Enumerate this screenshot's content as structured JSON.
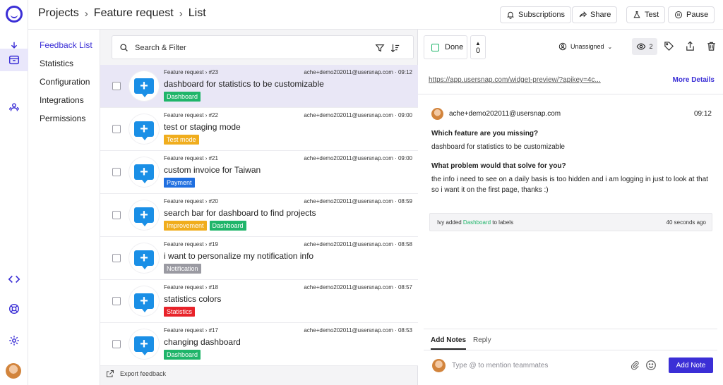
{
  "header": {
    "breadcrumb": [
      "Projects",
      "Feature request",
      "List"
    ],
    "buttons": {
      "subscriptions": "Subscriptions",
      "share": "Share",
      "test": "Test",
      "pause": "Pause"
    }
  },
  "rail": {
    "icons": [
      "download-icon",
      "inbox-icon",
      "team-icon",
      "code-icon",
      "lifebuoy-icon",
      "gear-icon"
    ]
  },
  "subnav": {
    "items": [
      "Feedback List",
      "Statistics",
      "Configuration",
      "Integrations",
      "Permissions"
    ]
  },
  "list": {
    "search_placeholder": "Search & Filter",
    "export_label": "Export feedback",
    "rows": [
      {
        "meta": "Feature request › #23",
        "email": "ache+demo202011@usersnap.com",
        "time": "09:12",
        "title": "dashboard for statistics to be customizable",
        "labels": [
          {
            "text": "Dashboard",
            "color": "#1fb56a"
          }
        ]
      },
      {
        "meta": "Feature request › #22",
        "email": "ache+demo202011@usersnap.com",
        "time": "09:00",
        "title": "test or staging mode",
        "labels": [
          {
            "text": "Test mode",
            "color": "#f0ad1d"
          }
        ]
      },
      {
        "meta": "Feature request › #21",
        "email": "ache+demo202011@usersnap.com",
        "time": "09:00",
        "title": "custom invoice for Taiwan",
        "labels": [
          {
            "text": "Payment",
            "color": "#1f6fe0"
          }
        ]
      },
      {
        "meta": "Feature request › #20",
        "email": "ache+demo202011@usersnap.com",
        "time": "08:59",
        "title": "search bar for dashboard to find projects",
        "labels": [
          {
            "text": "Improvement",
            "color": "#f0ad1d"
          },
          {
            "text": "Dashboard",
            "color": "#1fb56a"
          }
        ]
      },
      {
        "meta": "Feature request › #19",
        "email": "ache+demo202011@usersnap.com",
        "time": "08:58",
        "title": "i want to personalize my notification info",
        "labels": [
          {
            "text": "Notification",
            "color": "#9a9aa2"
          }
        ]
      },
      {
        "meta": "Feature request › #18",
        "email": "ache+demo202011@usersnap.com",
        "time": "08:57",
        "title": "statistics colors",
        "labels": [
          {
            "text": "Statistics",
            "color": "#e8232a"
          }
        ]
      },
      {
        "meta": "Feature request › #17",
        "email": "ache+demo202011@usersnap.com",
        "time": "08:53",
        "title": "changing dashboard",
        "labels": [
          {
            "text": "Dashboard",
            "color": "#1fb56a"
          }
        ]
      }
    ]
  },
  "detail": {
    "done_label": "Done",
    "votes": "0",
    "assignee": "Unassigned",
    "views": "2",
    "url": "https://app.usersnap.com/widget-preview/?apikey=4c...",
    "more_details": "More Details",
    "author": "ache+demo202011@usersnap.com",
    "time": "09:12",
    "q1": "Which feature are you missing?",
    "a1": "dashboard for statistics to be customizable",
    "q2": "What problem would that solve for you?",
    "a2": "the info i need to see on a daily basis is too hidden and i am logging in just to look at that so i want it on the first page, thanks :)",
    "activity": {
      "prefix": "Ivy added ",
      "label": "Dashboard",
      "suffix": " to labels",
      "ago": "40 seconds ago"
    },
    "notes": {
      "tab_add": "Add Notes",
      "tab_reply": "Reply",
      "placeholder": "Type @ to mention teammates",
      "button": "Add Note"
    }
  }
}
